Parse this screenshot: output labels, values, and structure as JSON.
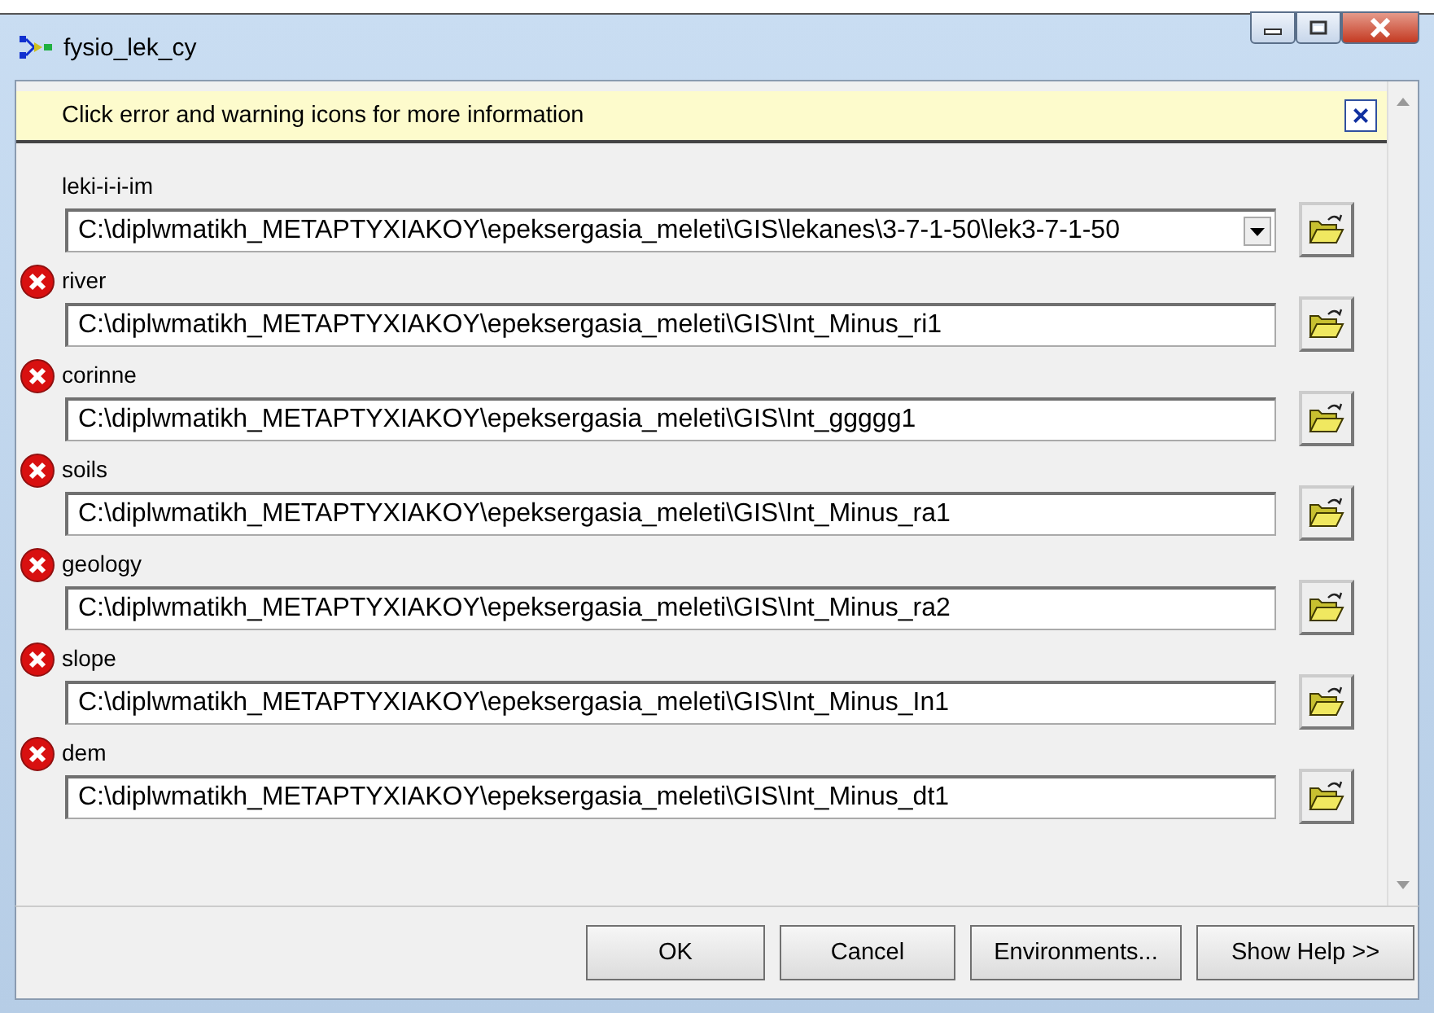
{
  "window": {
    "title": "fysio_lek_cy"
  },
  "info_bar": {
    "message": "Click error and warning icons for more information",
    "close": "×"
  },
  "params": [
    {
      "label": "leki-i-i-im",
      "kind": "combo",
      "error": false,
      "value": "C:\\diplwmatikh_METAPTYXIAKOY\\epeksergasia_meleti\\GIS\\lekanes\\3-7-1-50\\lek3-7-1-50"
    },
    {
      "label": "river",
      "kind": "text",
      "error": true,
      "value": "C:\\diplwmatikh_METAPTYXIAKOY\\epeksergasia_meleti\\GIS\\Int_Minus_ri1"
    },
    {
      "label": "corinne",
      "kind": "text",
      "error": true,
      "value": "C:\\diplwmatikh_METAPTYXIAKOY\\epeksergasia_meleti\\GIS\\Int_ggggg1"
    },
    {
      "label": "soils",
      "kind": "text",
      "error": true,
      "value": "C:\\diplwmatikh_METAPTYXIAKOY\\epeksergasia_meleti\\GIS\\Int_Minus_ra1"
    },
    {
      "label": "geology",
      "kind": "text",
      "error": true,
      "value": "C:\\diplwmatikh_METAPTYXIAKOY\\epeksergasia_meleti\\GIS\\Int_Minus_ra2"
    },
    {
      "label": "slope",
      "kind": "text",
      "error": true,
      "value": "C:\\diplwmatikh_METAPTYXIAKOY\\epeksergasia_meleti\\GIS\\Int_Minus_In1"
    },
    {
      "label": "dem",
      "kind": "text",
      "error": true,
      "value": "C:\\diplwmatikh_METAPTYXIAKOY\\epeksergasia_meleti\\GIS\\Int_Minus_dt1"
    }
  ],
  "buttons": [
    "OK",
    "Cancel",
    "Environments...",
    "Show Help >>"
  ]
}
